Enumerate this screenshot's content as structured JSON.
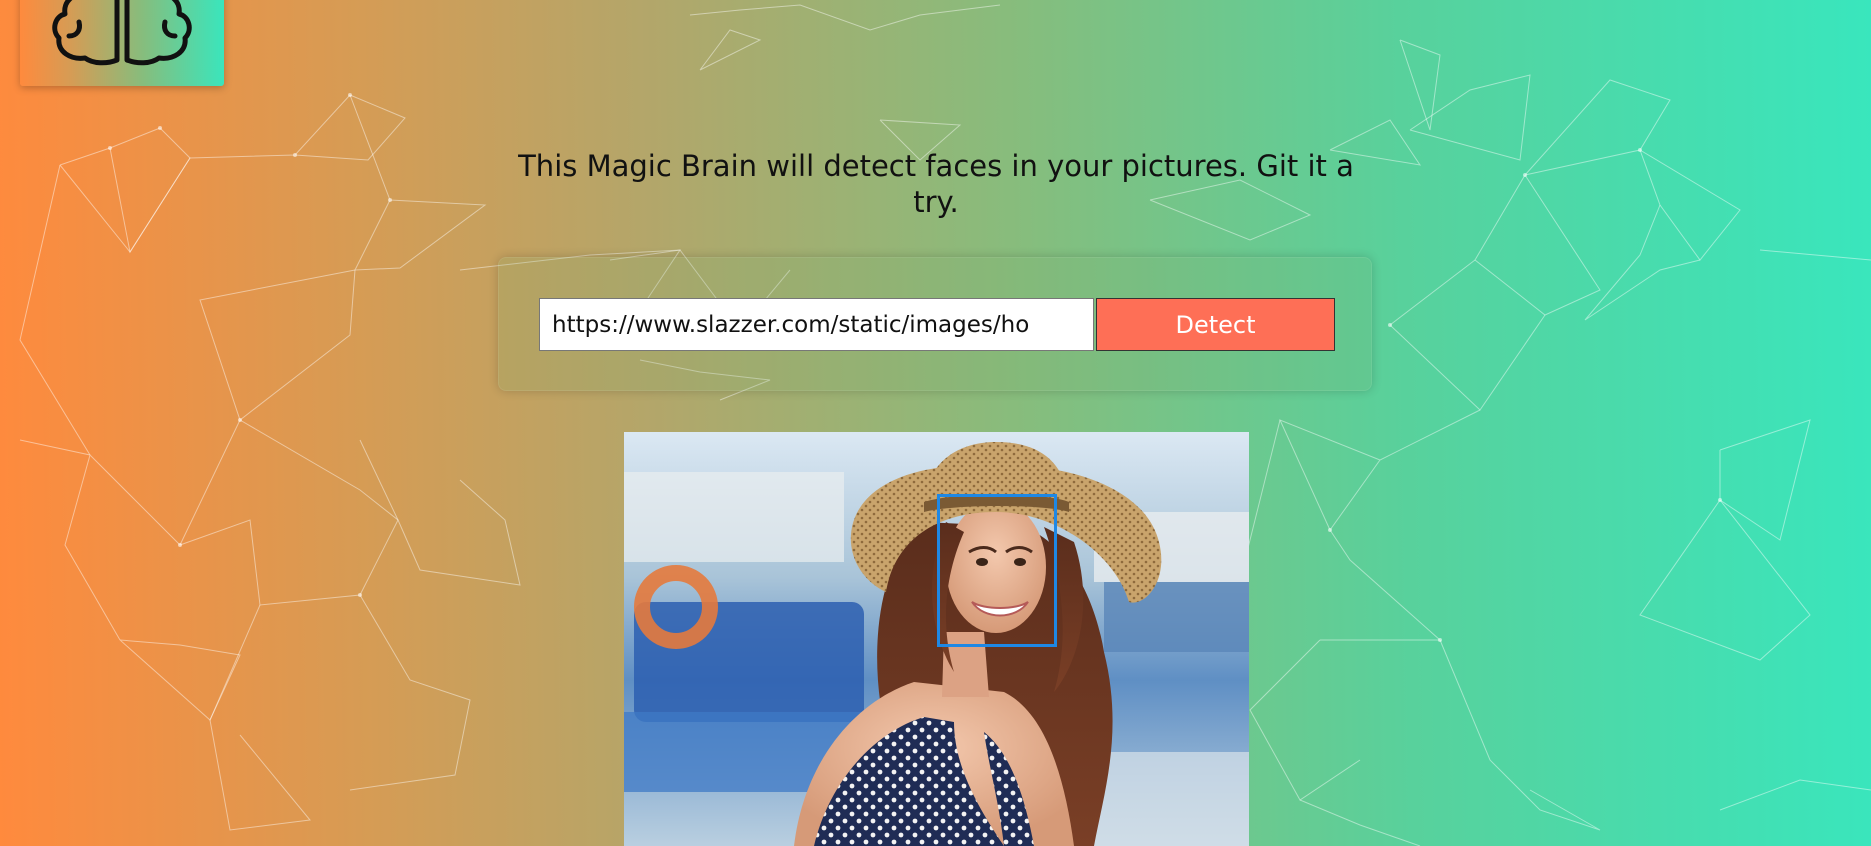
{
  "logo": {
    "icon": "brain-icon"
  },
  "header": {
    "headline": "This Magic Brain will detect faces in your pictures. Git it a try."
  },
  "form": {
    "input_value": "https://www.slazzer.com/static/images/ho",
    "detect_label": "Detect"
  },
  "result": {
    "image": "woman-in-straw-hat-photo",
    "face_box_color": "#1e88e5"
  },
  "colors": {
    "gradient_start": "#ff8a3d",
    "gradient_end": "#39e6bd",
    "button": "#fe6f56"
  }
}
